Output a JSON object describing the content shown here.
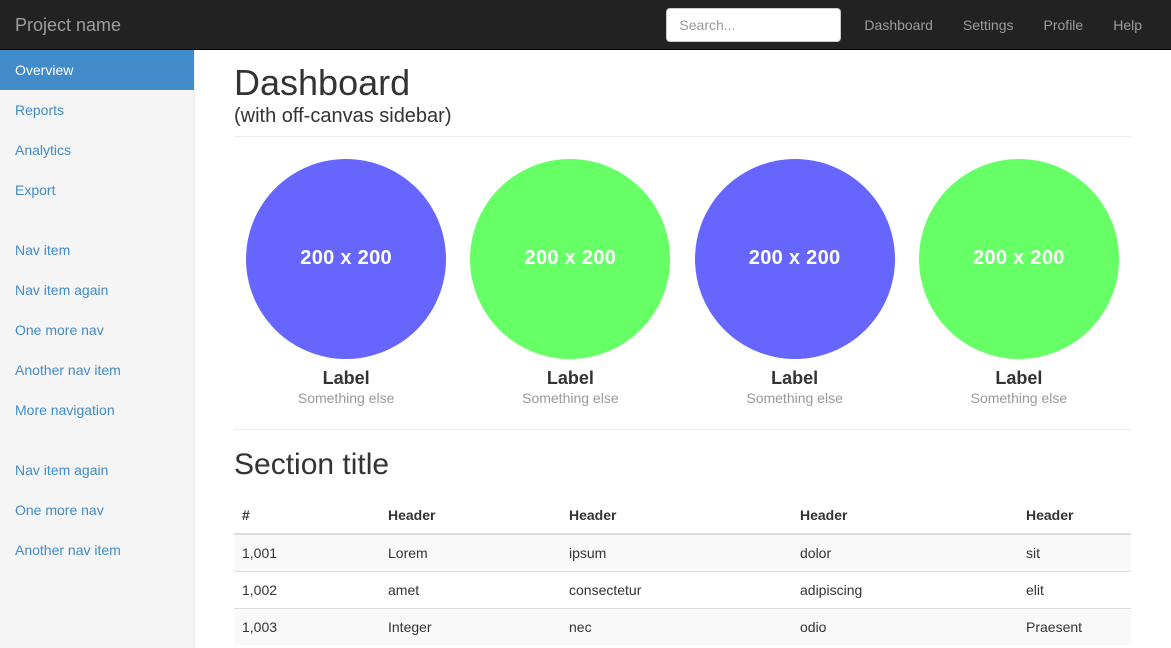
{
  "navbar": {
    "brand": "Project name",
    "search": {
      "placeholder": "Search...",
      "value": ""
    },
    "links": [
      {
        "label": "Dashboard"
      },
      {
        "label": "Settings"
      },
      {
        "label": "Profile"
      },
      {
        "label": "Help"
      }
    ]
  },
  "sidebar": {
    "group1": [
      {
        "label": "Overview",
        "active": true
      },
      {
        "label": "Reports",
        "active": false
      },
      {
        "label": "Analytics",
        "active": false
      },
      {
        "label": "Export",
        "active": false
      }
    ],
    "group2": [
      {
        "label": "Nav item"
      },
      {
        "label": "Nav item again"
      },
      {
        "label": "One more nav"
      },
      {
        "label": "Another nav item"
      },
      {
        "label": "More navigation"
      }
    ],
    "group3": [
      {
        "label": "Nav item again"
      },
      {
        "label": "One more nav"
      },
      {
        "label": "Another nav item"
      }
    ]
  },
  "main": {
    "title": "Dashboard",
    "subtitle": "(with off-canvas sidebar)",
    "section_title": "Section title",
    "colors": {
      "accent_blue": "#428bca",
      "circle_purple": "#6666ff",
      "circle_green": "#66ff66",
      "navbar_dark": "#222222",
      "sidebar_bg": "#f5f5f5"
    },
    "cards": [
      {
        "placeholder": "200 x 200",
        "color": "#6666ff",
        "label": "Label",
        "caption": "Something else"
      },
      {
        "placeholder": "200 x 200",
        "color": "#66ff66",
        "label": "Label",
        "caption": "Something else"
      },
      {
        "placeholder": "200 x 200",
        "color": "#6666ff",
        "label": "Label",
        "caption": "Something else"
      },
      {
        "placeholder": "200 x 200",
        "color": "#66ff66",
        "label": "Label",
        "caption": "Something else"
      }
    ],
    "table": {
      "headers": [
        "#",
        "Header",
        "Header",
        "Header",
        "Header"
      ],
      "rows": [
        [
          "1,001",
          "Lorem",
          "ipsum",
          "dolor",
          "sit"
        ],
        [
          "1,002",
          "amet",
          "consectetur",
          "adipiscing",
          "elit"
        ],
        [
          "1,003",
          "Integer",
          "nec",
          "odio",
          "Praesent"
        ]
      ]
    }
  }
}
